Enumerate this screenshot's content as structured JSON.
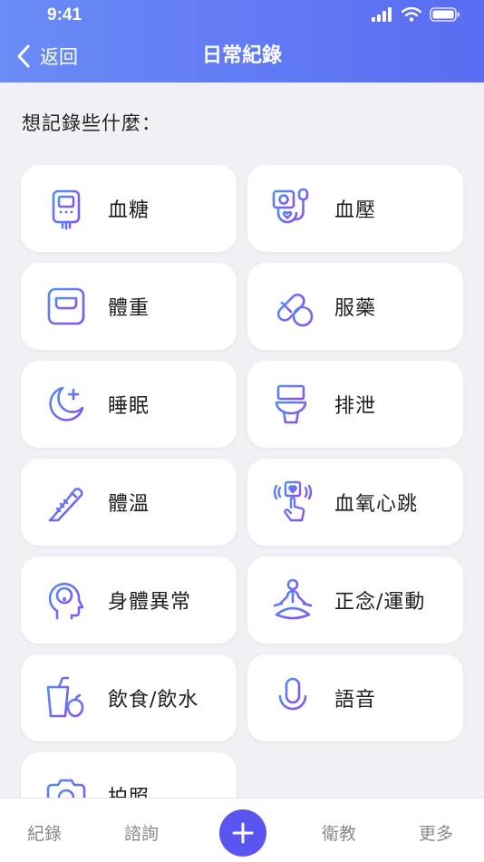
{
  "status": {
    "time": "9:41"
  },
  "header": {
    "back_label": "返回",
    "title": "日常紀錄"
  },
  "prompt": "想記錄些什麼：",
  "items": [
    {
      "label": "血糖",
      "icon": "glucose-meter-icon"
    },
    {
      "label": "血壓",
      "icon": "blood-pressure-icon"
    },
    {
      "label": "體重",
      "icon": "scale-icon"
    },
    {
      "label": "服藥",
      "icon": "pill-icon"
    },
    {
      "label": "睡眠",
      "icon": "moon-icon"
    },
    {
      "label": "排泄",
      "icon": "toilet-icon"
    },
    {
      "label": "體溫",
      "icon": "thermometer-icon"
    },
    {
      "label": "血氧心跳",
      "icon": "oximeter-icon"
    },
    {
      "label": "身體異常",
      "icon": "head-alert-icon"
    },
    {
      "label": "正念/運動",
      "icon": "meditation-icon"
    },
    {
      "label": "飲食/飲水",
      "icon": "food-drink-icon"
    },
    {
      "label": "語音",
      "icon": "microphone-icon"
    },
    {
      "label": "拍照",
      "icon": "camera-icon"
    }
  ],
  "tabs": {
    "records": "紀錄",
    "consult": "諮詢",
    "education": "衛教",
    "more": "更多"
  },
  "colors": {
    "accent": "#5a54f0",
    "header_start": "#6a8cf6",
    "header_end": "#5a6cf2"
  }
}
